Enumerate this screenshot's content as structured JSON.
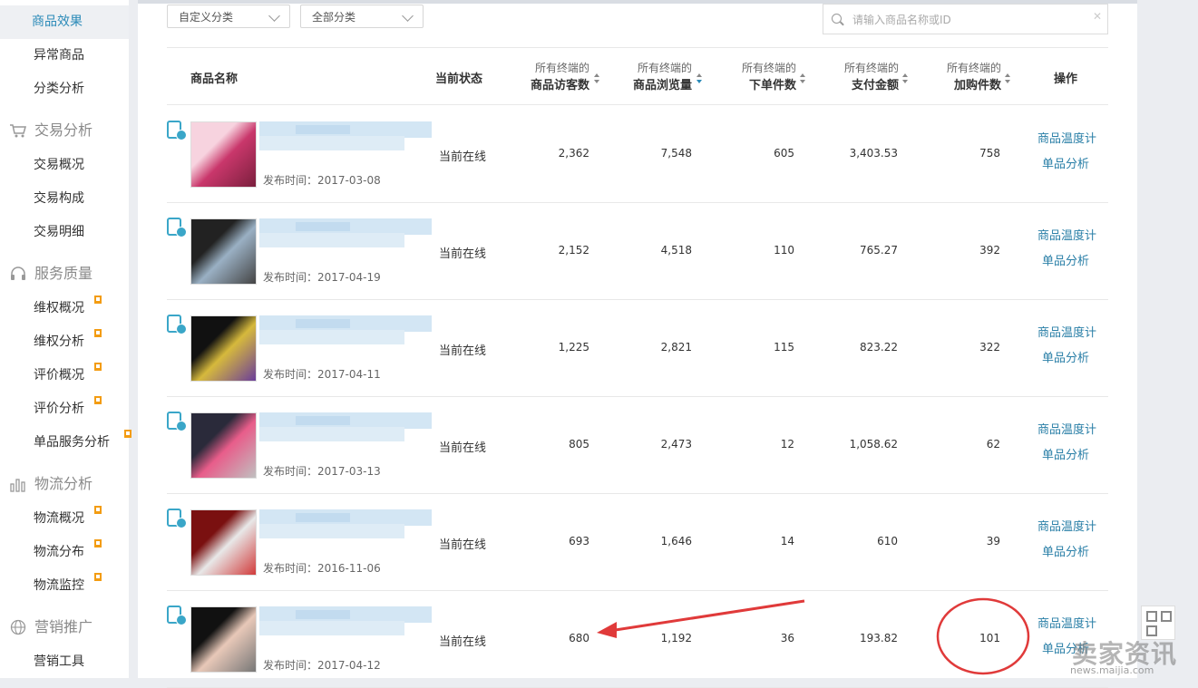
{
  "sidebar": {
    "items": [
      {
        "label": "商品效果",
        "active": true
      },
      {
        "label": "异常商品"
      },
      {
        "label": "分类分析"
      }
    ],
    "groups": [
      {
        "title": "交易分析",
        "icon": "cart-icon",
        "items": [
          {
            "label": "交易概况"
          },
          {
            "label": "交易构成"
          },
          {
            "label": "交易明细"
          }
        ]
      },
      {
        "title": "服务质量",
        "icon": "headset-icon",
        "items": [
          {
            "label": "维权概况",
            "flag": true
          },
          {
            "label": "维权分析",
            "flag": true
          },
          {
            "label": "评价概况",
            "flag": true
          },
          {
            "label": "评价分析",
            "flag": true
          },
          {
            "label": "单品服务分析",
            "flag": true
          }
        ]
      },
      {
        "title": "物流分析",
        "icon": "bar-chart-icon",
        "items": [
          {
            "label": "物流概况",
            "flag": true
          },
          {
            "label": "物流分布",
            "flag": true
          },
          {
            "label": "物流监控",
            "flag": true
          }
        ]
      },
      {
        "title": "营销推广",
        "icon": "globe-icon",
        "items": [
          {
            "label": "营销工具"
          }
        ]
      }
    ]
  },
  "filters": {
    "custom_category": "自定义分类",
    "all_category": "全部分类",
    "search_placeholder": "请输入商品名称或ID"
  },
  "table": {
    "headers": {
      "name": "商品名称",
      "status": "当前状态",
      "prefix": "所有终端的",
      "visitors": "商品访客数",
      "views": "商品浏览量",
      "orders": "下单件数",
      "amount": "支付金额",
      "cart": "加购件数",
      "action": "操作"
    },
    "rows": [
      {
        "publish": "发布时间：2017-03-08",
        "status": "当前在线",
        "visitors": "2,362",
        "views": "7,548",
        "orders": "605",
        "amount": "3,403.53",
        "cart": "758",
        "thermo": "商品温度计",
        "single": "单品分析"
      },
      {
        "publish": "发布时间：2017-04-19",
        "status": "当前在线",
        "visitors": "2,152",
        "views": "4,518",
        "orders": "110",
        "amount": "765.27",
        "cart": "392",
        "thermo": "商品温度计",
        "single": "单品分析"
      },
      {
        "publish": "发布时间：2017-04-11",
        "status": "当前在线",
        "visitors": "1,225",
        "views": "2,821",
        "orders": "115",
        "amount": "823.22",
        "cart": "322",
        "thermo": "商品温度计",
        "single": "单品分析"
      },
      {
        "publish": "发布时间：2017-03-13",
        "status": "当前在线",
        "visitors": "805",
        "views": "2,473",
        "orders": "12",
        "amount": "1,058.62",
        "cart": "62",
        "thermo": "商品温度计",
        "single": "单品分析"
      },
      {
        "publish": "发布时间：2016-11-06",
        "status": "当前在线",
        "visitors": "693",
        "views": "1,646",
        "orders": "14",
        "amount": "610",
        "cart": "39",
        "thermo": "商品温度计",
        "single": "单品分析"
      },
      {
        "publish": "发布时间：2017-04-12",
        "status": "当前在线",
        "visitors": "680",
        "views": "1,192",
        "orders": "36",
        "amount": "193.82",
        "cart": "101",
        "thermo": "商品温度计",
        "single": "单品分析"
      }
    ]
  },
  "watermark": {
    "text": "卖家资讯",
    "sub": "news.maijia.com"
  },
  "colors": {
    "accent": "#2a8ab8",
    "link": "#2a7fa7",
    "annotation": "#e03a3a",
    "flag": "#f39c12"
  }
}
